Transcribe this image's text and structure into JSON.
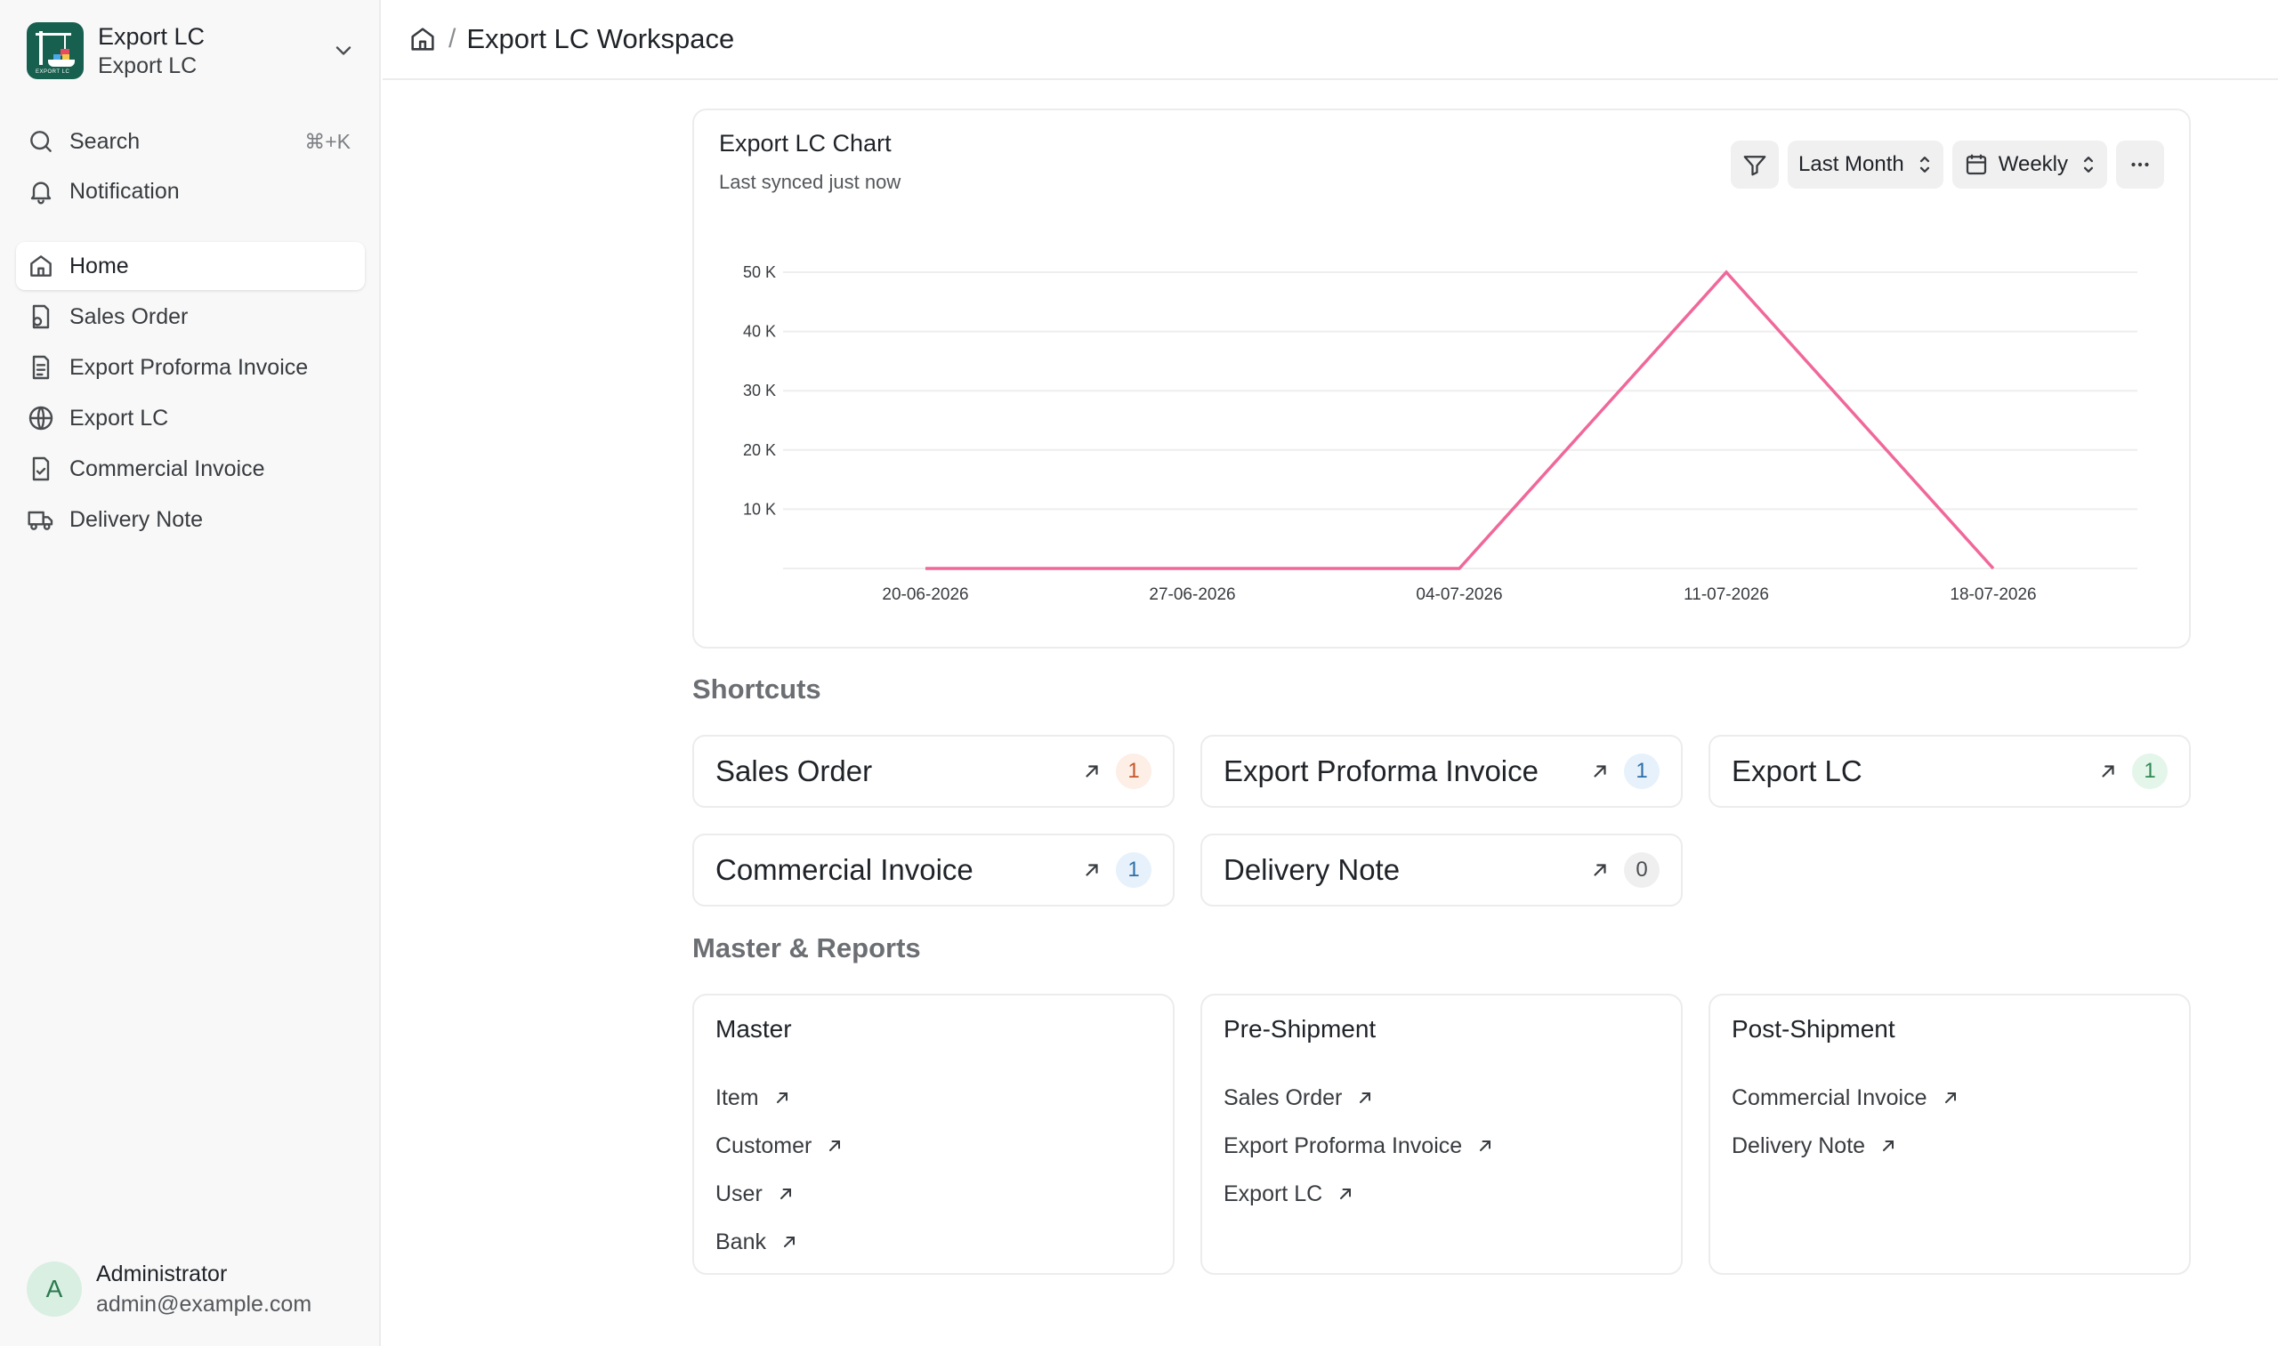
{
  "app": {
    "title": "Export LC",
    "subtitle": "Export LC",
    "logo_text": "EXPORT LC"
  },
  "sidebar": {
    "search_label": "Search",
    "search_shortcut": "⌘+K",
    "notification_label": "Notification",
    "items": [
      {
        "label": "Home",
        "icon": "home-icon",
        "active": true
      },
      {
        "label": "Sales Order",
        "icon": "sales-order-icon"
      },
      {
        "label": "Export Proforma Invoice",
        "icon": "document-icon"
      },
      {
        "label": "Export LC",
        "icon": "globe-icon"
      },
      {
        "label": "Commercial Invoice",
        "icon": "file-check-icon"
      },
      {
        "label": "Delivery Note",
        "icon": "truck-icon"
      }
    ]
  },
  "user": {
    "initial": "A",
    "name": "Administrator",
    "email": "admin@example.com"
  },
  "breadcrumb": {
    "page": "Export LC Workspace"
  },
  "chart_card": {
    "title": "Export LC Chart",
    "subtitle": "Last synced just now",
    "period": "Last Month",
    "interval": "Weekly"
  },
  "chart_data": {
    "type": "line",
    "x": [
      "20-06-2026",
      "27-06-2026",
      "04-07-2026",
      "11-07-2026",
      "18-07-2026"
    ],
    "series": [
      {
        "values": [
          0,
          0,
          0,
          50000,
          0
        ],
        "color": "#f0689a"
      }
    ],
    "ylim": [
      0,
      50000
    ],
    "yticks": [
      10000,
      20000,
      30000,
      40000,
      50000
    ],
    "ytick_labels": [
      "10 K",
      "20 K",
      "30 K",
      "40 K",
      "50 K"
    ],
    "grid": true
  },
  "shortcuts_heading": "Shortcuts",
  "shortcuts": [
    {
      "label": "Sales Order",
      "count": "1",
      "badge_bg": "#fdeee6",
      "badge_fg": "#c4572c"
    },
    {
      "label": "Export Proforma Invoice",
      "count": "1",
      "badge_bg": "#e6f1fb",
      "badge_fg": "#2d6fa8"
    },
    {
      "label": "Export LC",
      "count": "1",
      "badge_bg": "#e4f5ea",
      "badge_fg": "#2f8a55"
    },
    {
      "label": "Commercial Invoice",
      "count": "1",
      "badge_bg": "#e6f1fb",
      "badge_fg": "#2d6fa8"
    },
    {
      "label": "Delivery Note",
      "count": "0",
      "badge_bg": "#efefef",
      "badge_fg": "#4a4d50"
    }
  ],
  "reports_heading": "Master & Reports",
  "reports": [
    {
      "title": "Master",
      "links": [
        "Item",
        "Customer",
        "User",
        "Bank"
      ]
    },
    {
      "title": "Pre-Shipment",
      "links": [
        "Sales Order",
        "Export Proforma Invoice",
        "Export LC"
      ]
    },
    {
      "title": "Post-Shipment",
      "links": [
        "Commercial Invoice",
        "Delivery Note"
      ]
    }
  ]
}
